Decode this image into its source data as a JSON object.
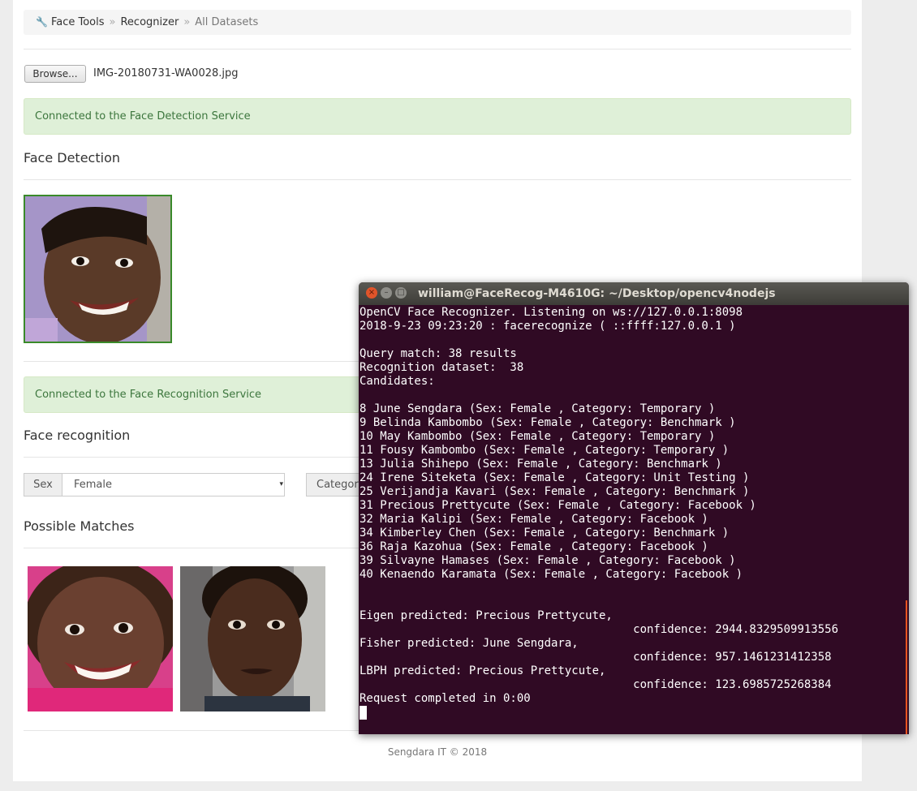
{
  "breadcrumb": {
    "items": [
      "Face Tools",
      "Recognizer",
      "All Datasets"
    ],
    "separator": "»"
  },
  "upload": {
    "browse_label": "Browse...",
    "filename": "IMG-20180731-WA0028.jpg"
  },
  "alerts": {
    "detection": "Connected to the Face Detection Service",
    "recognition": "Connected to the Face Recognition Service"
  },
  "sections": {
    "face_detection": "Face Detection",
    "face_recognition": "Face recognition",
    "possible_matches": "Possible Matches"
  },
  "filters": {
    "sex_label": "Sex",
    "sex_value": "Female",
    "category_label": "Category"
  },
  "footer": "Sengdara IT © 2018",
  "terminal": {
    "title": "william@FaceRecog-M4610G: ~/Desktop/opencv4nodejs",
    "lines": [
      "OpenCV Face Recognizer. Listening on ws://127.0.0.1:8098",
      "2018-9-23 09:23:20 : facerecognize ( ::ffff:127.0.0.1 )",
      "",
      "Query match: 38 results",
      "Recognition dataset:  38",
      "Candidates:",
      "",
      "8 June Sengdara (Sex: Female , Category: Temporary )",
      "9 Belinda Kambombo (Sex: Female , Category: Benchmark )",
      "10 May Kambombo (Sex: Female , Category: Temporary )",
      "11 Fousy Kambombo (Sex: Female , Category: Temporary )",
      "13 Julia Shihepo (Sex: Female , Category: Benchmark )",
      "24 Irene Siteketa (Sex: Female , Category: Unit Testing )",
      "25 Verijandja Kavari (Sex: Female , Category: Benchmark )",
      "31 Precious Prettycute (Sex: Female , Category: Facebook )",
      "32 Maria Kalipi (Sex: Female , Category: Facebook )",
      "34 Kimberley Chen (Sex: Female , Category: Benchmark )",
      "36 Raja Kazohua (Sex: Female , Category: Facebook )",
      "39 Silvayne Hamases (Sex: Female , Category: Facebook )",
      "40 Kenaendo Karamata (Sex: Female , Category: Facebook )",
      "",
      "",
      "Eigen predicted: Precious Prettycute,",
      "                                        confidence: 2944.8329509913556",
      "Fisher predicted: June Sengdara,",
      "                                        confidence: 957.1461231412358",
      "LBPH predicted: Precious Prettycute,",
      "                                        confidence: 123.6985725268384",
      "Request completed in 0:00"
    ]
  }
}
